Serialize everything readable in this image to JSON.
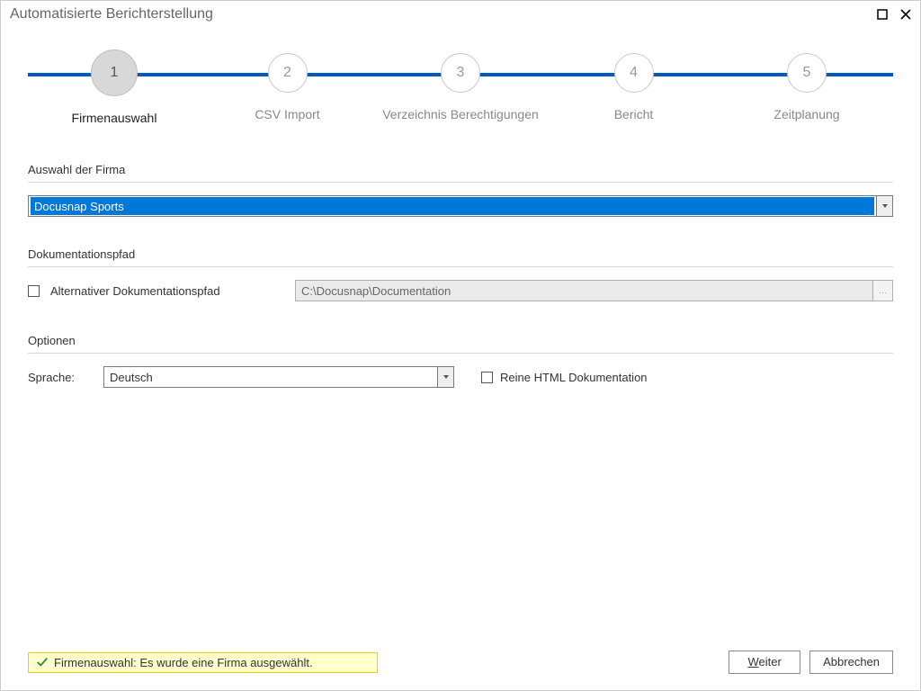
{
  "title": "Automatisierte Berichterstellung",
  "steps": [
    {
      "num": "1",
      "label": "Firmenauswahl",
      "active": true
    },
    {
      "num": "2",
      "label": "CSV Import",
      "active": false
    },
    {
      "num": "3",
      "label": "Verzeichnis Berechtigungen",
      "active": false
    },
    {
      "num": "4",
      "label": "Bericht",
      "active": false
    },
    {
      "num": "5",
      "label": "Zeitplanung",
      "active": false
    }
  ],
  "sections": {
    "company": {
      "title": "Auswahl der Firma",
      "selected": "Docusnap Sports"
    },
    "docpath": {
      "title": "Dokumentationspfad",
      "checkbox_label": "Alternativer Dokumentationspfad",
      "path_value": "C:\\Docusnap\\Documentation"
    },
    "options": {
      "title": "Optionen",
      "language_label": "Sprache:",
      "language_value": "Deutsch",
      "html_only_label": "Reine HTML Dokumentation"
    }
  },
  "status": "Firmenauswahl: Es wurde eine Firma ausgewählt.",
  "buttons": {
    "next_u": "W",
    "next_rest": "eiter",
    "cancel": "Abbrechen"
  }
}
